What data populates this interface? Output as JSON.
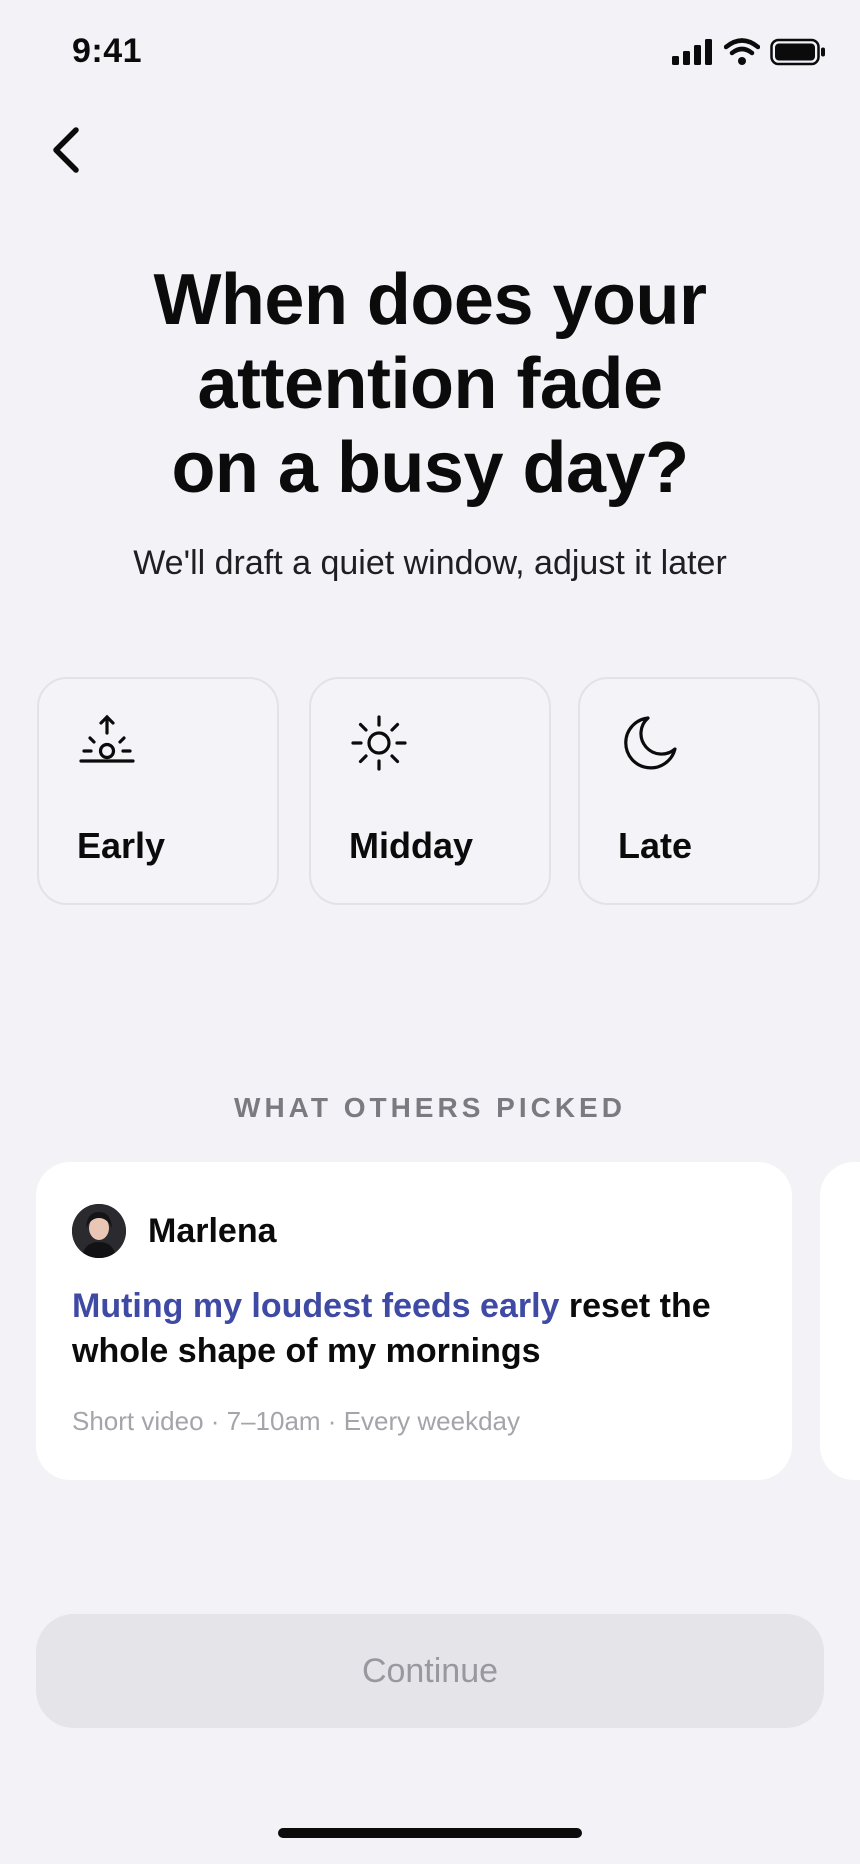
{
  "status_bar": {
    "time": "9:41"
  },
  "header": {
    "title": "When does your attention fade on a busy day?",
    "subtitle": "We'll draft a quiet window, adjust it later"
  },
  "options": [
    {
      "label": "Early",
      "icon": "sunrise-icon"
    },
    {
      "label": "Midday",
      "icon": "sun-icon"
    },
    {
      "label": "Late",
      "icon": "moon-icon"
    }
  ],
  "others": {
    "section_label": "WHAT OTHERS PICKED",
    "cards": [
      {
        "name": "Marlena",
        "quote_highlight": "Muting my loudest feeds early",
        "quote_rest": " reset the whole shape of my mornings",
        "meta": "Short video · 7–10am · Every weekday"
      }
    ]
  },
  "footer": {
    "continue_label": "Continue"
  },
  "colors": {
    "accent": "#3e4aa3",
    "background": "#f2f2f7",
    "disabled_button": "#e4e4e9"
  }
}
